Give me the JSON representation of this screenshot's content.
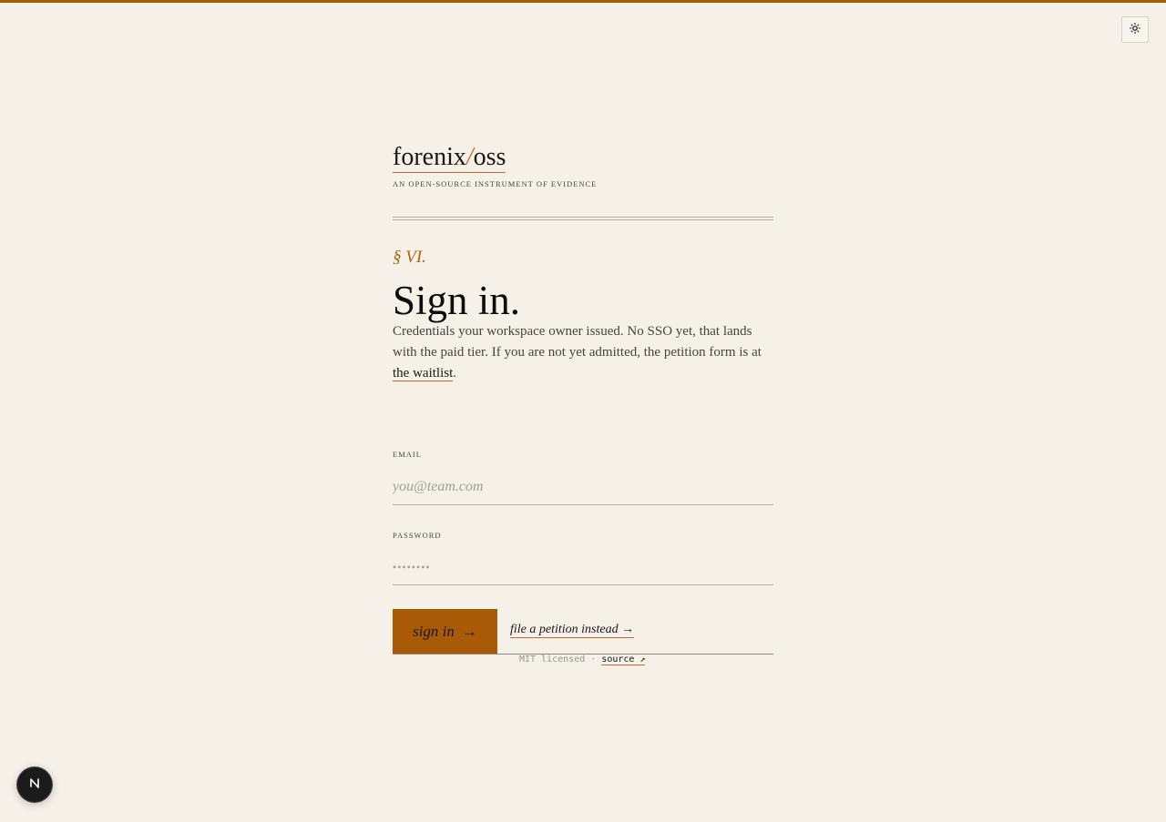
{
  "brand": {
    "name_left": "forenix",
    "name_sep": "/",
    "name_right": "oss",
    "tagline": "AN OPEN-SOURCE INSTRUMENT OF EVIDENCE"
  },
  "header": {
    "theme_toggle_icon": "sun-icon"
  },
  "signin": {
    "section_num": "§ VI.",
    "title": "Sign in.",
    "lede_text": "Credentials your workspace owner issued. No SSO yet, that lands with the paid tier. If you are not yet admitted, the petition form is at ",
    "lede_link": "the waitlist",
    "lede_end": "."
  },
  "form": {
    "email_label": "EMAIL",
    "email_placeholder": "you@team.com",
    "email_value": "",
    "password_label": "PASSWORD",
    "password_placeholder": "••••••••",
    "password_value": "",
    "submit_label": "sign in",
    "submit_arrow": "→",
    "petition_label": "file a petition instead →"
  },
  "footer": {
    "license": "MIT licensed · ",
    "source_link": "source ↗"
  },
  "dev_badge": {
    "icon": "next-n-icon",
    "letter": "N"
  },
  "colors": {
    "accent": "#a85a06",
    "underline": "#c96a2c",
    "background": "#f5f1e8"
  }
}
